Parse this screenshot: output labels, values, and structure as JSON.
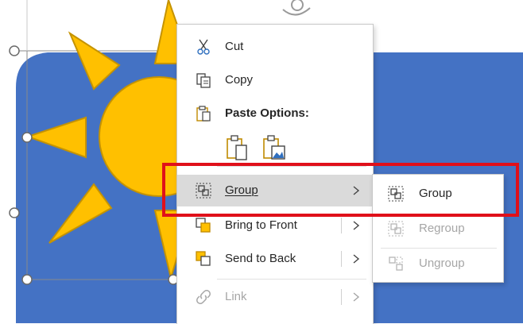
{
  "colors": {
    "slide_blue": "#4472c4",
    "sun_yellow": "#ffc000",
    "sun_outline": "#c59300",
    "highlight": "#dadada",
    "annotation_red": "#e0101a"
  },
  "context_menu": {
    "items": [
      {
        "label": "Cut",
        "icon": "scissors-icon",
        "enabled": true
      },
      {
        "label": "Copy",
        "icon": "copy-icon",
        "enabled": true
      },
      {
        "label": "Paste Options:",
        "icon": "paste-icon",
        "enabled": true
      },
      {
        "label": "Group",
        "icon": "group-icon",
        "enabled": true,
        "highlighted": true,
        "has_submenu": true
      },
      {
        "label": "Bring to Front",
        "icon": "bring-to-front-icon",
        "enabled": true,
        "has_submenu": true
      },
      {
        "label": "Send to Back",
        "icon": "send-to-back-icon",
        "enabled": true,
        "has_submenu": true
      },
      {
        "label": "Link",
        "icon": "link-icon",
        "enabled": false,
        "has_submenu": true
      }
    ],
    "paste_option_icons": [
      "paste-keep-source-icon",
      "paste-picture-icon"
    ]
  },
  "submenu": {
    "items": [
      {
        "label": "Group",
        "icon": "group-icon",
        "enabled": true
      },
      {
        "label": "Regroup",
        "icon": "regroup-icon",
        "enabled": false
      },
      {
        "label": "Ungroup",
        "icon": "ungroup-icon",
        "enabled": false
      }
    ]
  }
}
